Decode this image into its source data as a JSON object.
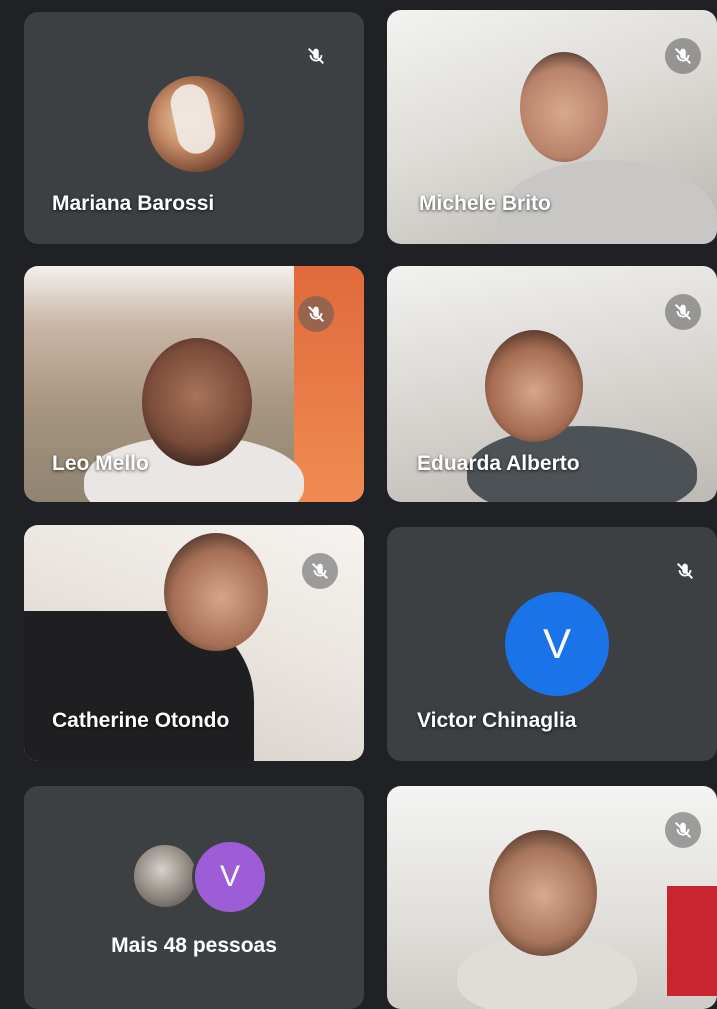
{
  "participants": [
    {
      "name": "Mariana Barossi",
      "muted": true,
      "avatar": "photo"
    },
    {
      "name": "Michele Brito",
      "muted": true,
      "video": true
    },
    {
      "name": "Leo Mello",
      "muted": true,
      "video": true
    },
    {
      "name": "Eduarda Alberto",
      "muted": true,
      "video": true
    },
    {
      "name": "Catherine Otondo",
      "muted": true,
      "video": true
    },
    {
      "name": "Victor Chinaglia",
      "muted": true,
      "avatar_letter": "V"
    },
    {
      "name": "",
      "muted": true,
      "video": true
    }
  ],
  "overflow": {
    "label": "Mais 48 pessoas",
    "avatar_letter": "V"
  },
  "icons": {
    "mute": "mic-off-icon"
  },
  "colors": {
    "background": "#202124",
    "tile": "#3c4043",
    "avatar_blue": "#1a73e8",
    "avatar_purple": "#9c5dd6"
  }
}
